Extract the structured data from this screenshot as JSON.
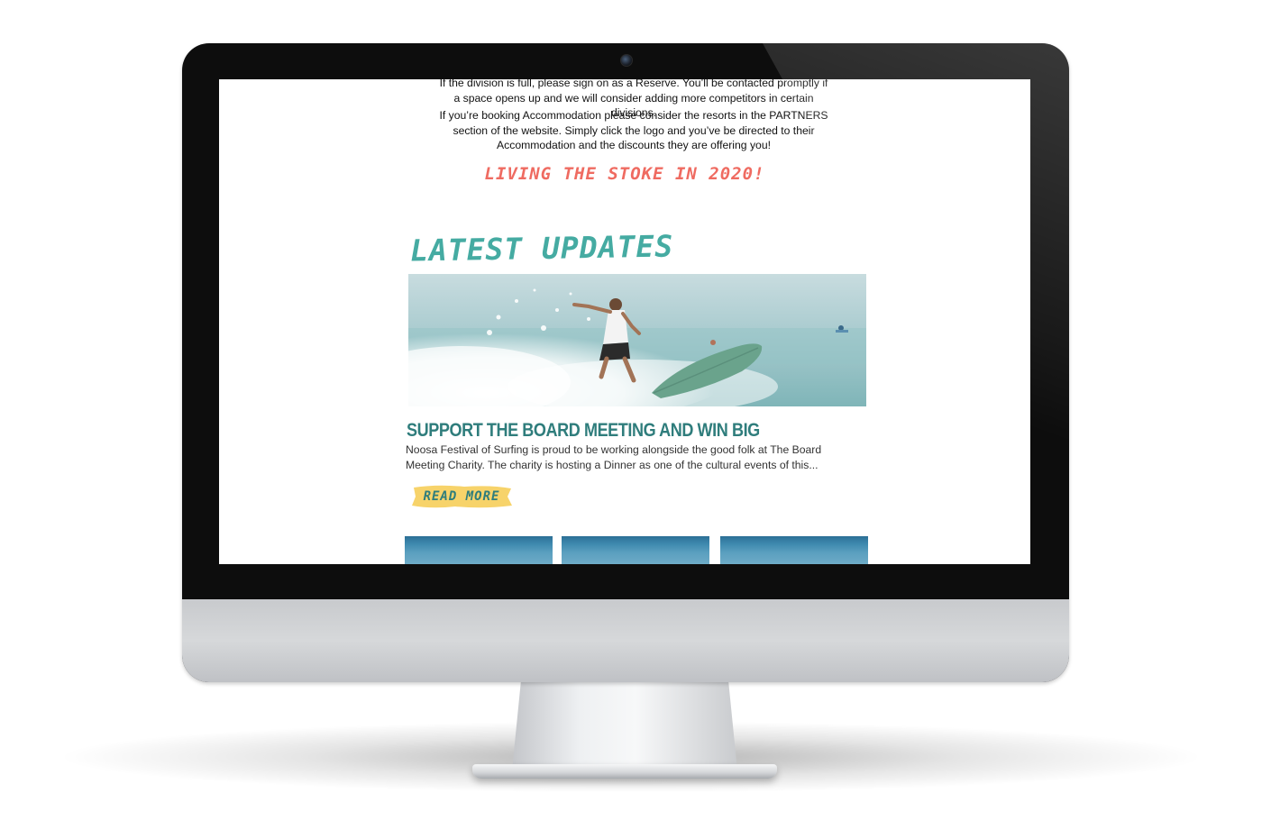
{
  "page": {
    "intro_paragraph_1": "If the division is full, please sign on as a Reserve. You’ll be contacted promptly if a space opens up and we will consider adding more competitors in certain divisions.",
    "intro_paragraph_2": "If you’re booking Accommodation please consider the resorts in the PARTNERS section of the website. Simply click the logo and you’ve be directed to their Accommodation and the discounts they are offering you!",
    "tagline": "Living the Stoke in 2020!",
    "section_heading": "Latest Updates"
  },
  "featured_post": {
    "title": "SUPPORT THE BOARD MEETING AND WIN BIG",
    "excerpt": "Noosa Festival of Surfing is proud to be working alongside the good folk at The Board Meeting Charity. The charity is hosting a Dinner  as one of the cultural events of this...",
    "read_more_label": "Read More",
    "image_alt": "surfer-on-longboard-photo"
  },
  "colors": {
    "accent_coral": "#ef6b61",
    "accent_teal": "#45aba2",
    "title_teal": "#2f7d7c",
    "button_yellow": "#f7d36a"
  }
}
